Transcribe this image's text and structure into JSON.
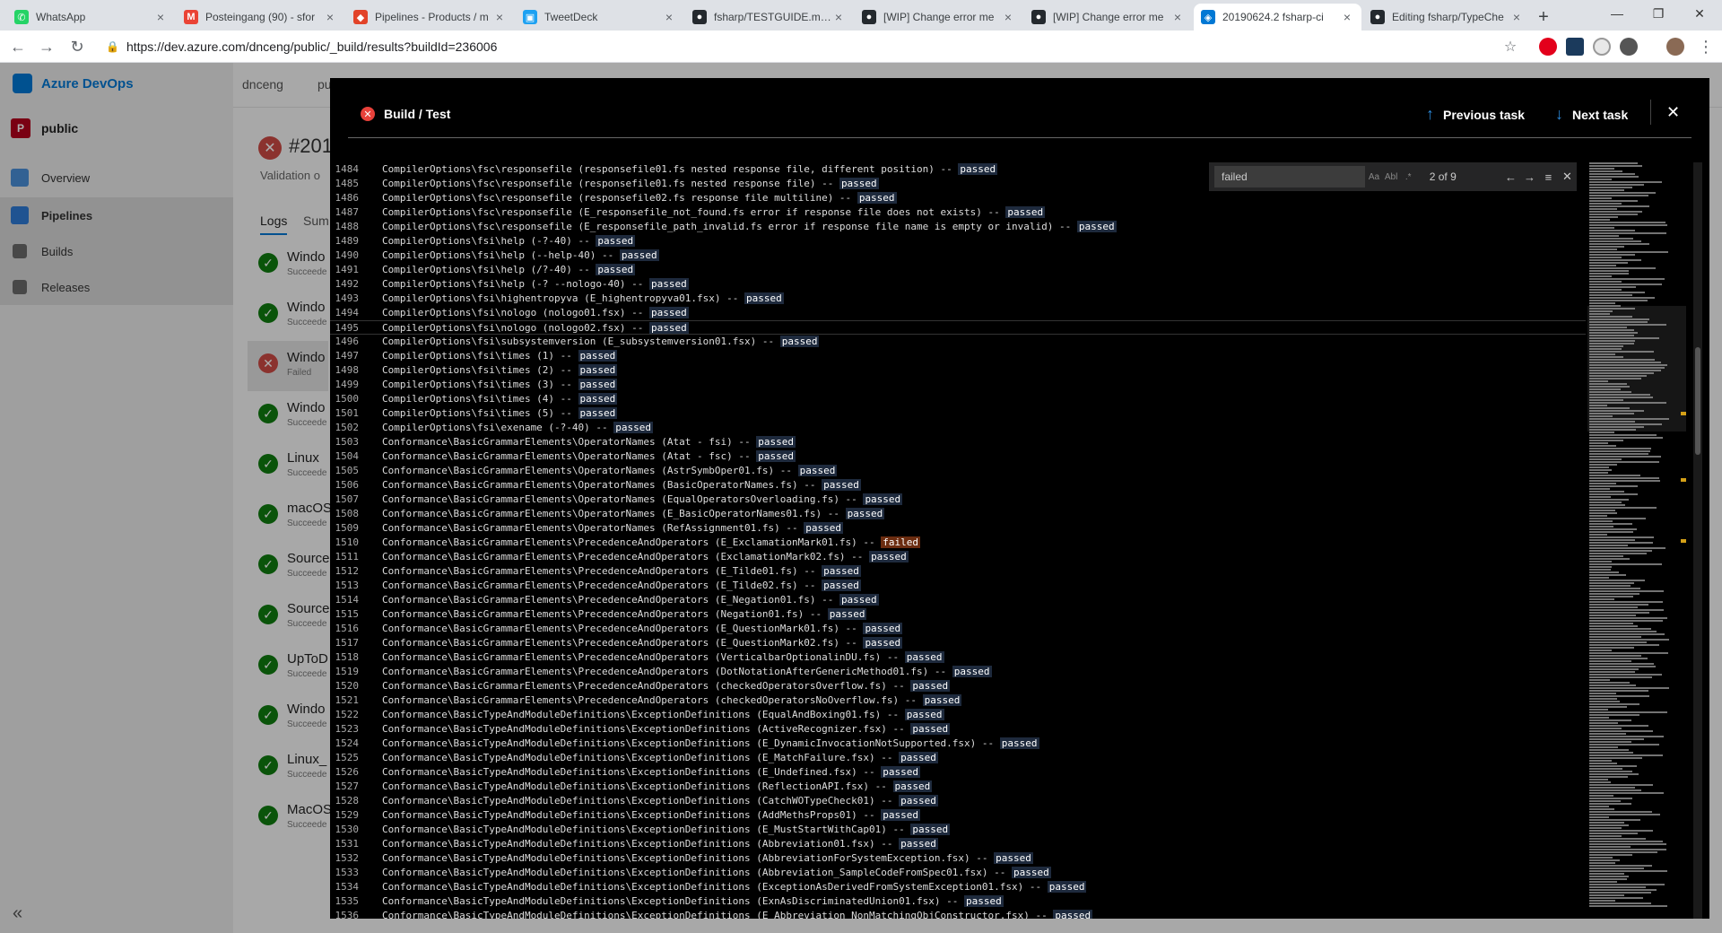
{
  "browser": {
    "tabs": [
      {
        "title": "WhatsApp",
        "icon": "whatsapp-icon",
        "color": "#25d366",
        "glyph": "✆"
      },
      {
        "title": "Posteingang (90) - sfor",
        "icon": "gmail-icon",
        "color": "#ea4335",
        "glyph": "M"
      },
      {
        "title": "Pipelines - Products / m",
        "icon": "gitlab-icon",
        "color": "#e24329",
        "glyph": "◆"
      },
      {
        "title": "TweetDeck",
        "icon": "tweetdeck-icon",
        "color": "#1da1f2",
        "glyph": "▣"
      },
      {
        "title": "fsharp/TESTGUIDE.md a",
        "icon": "github-icon",
        "color": "#24292e",
        "glyph": "●"
      },
      {
        "title": "[WIP] Change error me",
        "icon": "github-pr-icon",
        "color": "#24292e",
        "glyph": "●"
      },
      {
        "title": "[WIP] Change error me",
        "icon": "github-pr-icon",
        "color": "#24292e",
        "glyph": "●"
      },
      {
        "title": "20190624.2 fsharp-ci",
        "icon": "azure-devops-icon",
        "color": "#0078d4",
        "glyph": "◈",
        "active": true
      },
      {
        "title": "Editing fsharp/TypeChe",
        "icon": "github-icon",
        "color": "#24292e",
        "glyph": "●"
      }
    ],
    "url": "https://dev.azure.com/dnceng/public/_build/results?buildId=236006"
  },
  "ado": {
    "brand": "Azure DevOps",
    "org": "dnceng",
    "project_crumb": "pu",
    "project": "public",
    "project_initial": "P",
    "nav": {
      "overview": "Overview",
      "pipelines": "Pipelines",
      "builds": "Builds",
      "releases": "Releases"
    },
    "run_title": "#201",
    "run_sub": "Validation o",
    "tab_logs": "Logs",
    "tab_summary": "Sum",
    "jobs": [
      {
        "name": "Windo",
        "status": "Succeede",
        "ok": true
      },
      {
        "name": "Windo",
        "status": "Succeede",
        "ok": true
      },
      {
        "name": "Windo",
        "status": "Failed",
        "ok": false,
        "selected": true
      },
      {
        "name": "Windo",
        "status": "Succeede",
        "ok": true
      },
      {
        "name": "Linux",
        "status": "Succeede",
        "ok": true
      },
      {
        "name": "macOS",
        "status": "Succeede",
        "ok": true
      },
      {
        "name": "Source",
        "status": "Succeede",
        "ok": true
      },
      {
        "name": "Source",
        "status": "Succeede",
        "ok": true
      },
      {
        "name": "UpToD",
        "status": "Succeede",
        "ok": true
      },
      {
        "name": "Windo",
        "status": "Succeede",
        "ok": true
      },
      {
        "name": "Linux_",
        "status": "Succeede",
        "ok": true
      },
      {
        "name": "MacOS",
        "status": "Succeede",
        "ok": true
      }
    ]
  },
  "dialog": {
    "title": "Build / Test",
    "prev_task": "Previous task",
    "next_task": "Next task",
    "find": {
      "query": "failed",
      "count": "2 of 9",
      "opt_case": "Aa",
      "opt_word": "Abl",
      "opt_regex": ".*"
    },
    "current_line": 1495,
    "log_lines": [
      {
        "n": 1484,
        "text": "CompilerOptions\\fsc\\responsefile (responsefile01.fs nested response file, different position) -- ",
        "result": "passed"
      },
      {
        "n": 1485,
        "text": "CompilerOptions\\fsc\\responsefile (responsefile01.fs nested response file) -- ",
        "result": "passed"
      },
      {
        "n": 1486,
        "text": "CompilerOptions\\fsc\\responsefile (responsefile02.fs response file multiline) -- ",
        "result": "passed"
      },
      {
        "n": 1487,
        "text": "CompilerOptions\\fsc\\responsefile (E_responsefile_not_found.fs error if response file does not exists) -- ",
        "result": "passed"
      },
      {
        "n": 1488,
        "text": "CompilerOptions\\fsc\\responsefile (E_responsefile_path_invalid.fs error if response file name is empty or invalid) -- ",
        "result": "passed"
      },
      {
        "n": 1489,
        "text": "CompilerOptions\\fsi\\help (-?-40) -- ",
        "result": "passed"
      },
      {
        "n": 1490,
        "text": "CompilerOptions\\fsi\\help (--help-40) -- ",
        "result": "passed"
      },
      {
        "n": 1491,
        "text": "CompilerOptions\\fsi\\help (/?-40) -- ",
        "result": "passed"
      },
      {
        "n": 1492,
        "text": "CompilerOptions\\fsi\\help (-? --nologo-40) -- ",
        "result": "passed"
      },
      {
        "n": 1493,
        "text": "CompilerOptions\\fsi\\highentropyva (E_highentropyva01.fsx) -- ",
        "result": "passed"
      },
      {
        "n": 1494,
        "text": "CompilerOptions\\fsi\\nologo (nologo01.fsx) -- ",
        "result": "passed"
      },
      {
        "n": 1495,
        "text": "CompilerOptions\\fsi\\nologo (nologo02.fsx) -- ",
        "result": "passed"
      },
      {
        "n": 1496,
        "text": "CompilerOptions\\fsi\\subsystemversion (E_subsystemversion01.fsx) -- ",
        "result": "passed"
      },
      {
        "n": 1497,
        "text": "CompilerOptions\\fsi\\times (1) -- ",
        "result": "passed"
      },
      {
        "n": 1498,
        "text": "CompilerOptions\\fsi\\times (2) -- ",
        "result": "passed"
      },
      {
        "n": 1499,
        "text": "CompilerOptions\\fsi\\times (3) -- ",
        "result": "passed"
      },
      {
        "n": 1500,
        "text": "CompilerOptions\\fsi\\times (4) -- ",
        "result": "passed"
      },
      {
        "n": 1501,
        "text": "CompilerOptions\\fsi\\times (5) -- ",
        "result": "passed"
      },
      {
        "n": 1502,
        "text": "CompilerOptions\\fsi\\exename (-?-40) -- ",
        "result": "passed"
      },
      {
        "n": 1503,
        "text": "Conformance\\BasicGrammarElements\\OperatorNames (Atat - fsi) -- ",
        "result": "passed"
      },
      {
        "n": 1504,
        "text": "Conformance\\BasicGrammarElements\\OperatorNames (Atat - fsc) -- ",
        "result": "passed"
      },
      {
        "n": 1505,
        "text": "Conformance\\BasicGrammarElements\\OperatorNames (AstrSymbOper01.fs) -- ",
        "result": "passed"
      },
      {
        "n": 1506,
        "text": "Conformance\\BasicGrammarElements\\OperatorNames (BasicOperatorNames.fs) -- ",
        "result": "passed"
      },
      {
        "n": 1507,
        "text": "Conformance\\BasicGrammarElements\\OperatorNames (EqualOperatorsOverloading.fs) -- ",
        "result": "passed"
      },
      {
        "n": 1508,
        "text": "Conformance\\BasicGrammarElements\\OperatorNames (E_BasicOperatorNames01.fs) -- ",
        "result": "passed"
      },
      {
        "n": 1509,
        "text": "Conformance\\BasicGrammarElements\\OperatorNames (RefAssignment01.fs) -- ",
        "result": "passed"
      },
      {
        "n": 1510,
        "text": "Conformance\\BasicGrammarElements\\PrecedenceAndOperators (E_ExclamationMark01.fs) -- ",
        "result": "failed"
      },
      {
        "n": 1511,
        "text": "Conformance\\BasicGrammarElements\\PrecedenceAndOperators (ExclamationMark02.fs) -- ",
        "result": "passed"
      },
      {
        "n": 1512,
        "text": "Conformance\\BasicGrammarElements\\PrecedenceAndOperators (E_Tilde01.fs) -- ",
        "result": "passed"
      },
      {
        "n": 1513,
        "text": "Conformance\\BasicGrammarElements\\PrecedenceAndOperators (E_Tilde02.fs) -- ",
        "result": "passed"
      },
      {
        "n": 1514,
        "text": "Conformance\\BasicGrammarElements\\PrecedenceAndOperators (E_Negation01.fs) -- ",
        "result": "passed"
      },
      {
        "n": 1515,
        "text": "Conformance\\BasicGrammarElements\\PrecedenceAndOperators (Negation01.fs) -- ",
        "result": "passed"
      },
      {
        "n": 1516,
        "text": "Conformance\\BasicGrammarElements\\PrecedenceAndOperators (E_QuestionMark01.fs) -- ",
        "result": "passed"
      },
      {
        "n": 1517,
        "text": "Conformance\\BasicGrammarElements\\PrecedenceAndOperators (E_QuestionMark02.fs) -- ",
        "result": "passed"
      },
      {
        "n": 1518,
        "text": "Conformance\\BasicGrammarElements\\PrecedenceAndOperators (VerticalbarOptionalinDU.fs) -- ",
        "result": "passed"
      },
      {
        "n": 1519,
        "text": "Conformance\\BasicGrammarElements\\PrecedenceAndOperators (DotNotationAfterGenericMethod01.fs) -- ",
        "result": "passed"
      },
      {
        "n": 1520,
        "text": "Conformance\\BasicGrammarElements\\PrecedenceAndOperators (checkedOperatorsOverflow.fs) -- ",
        "result": "passed"
      },
      {
        "n": 1521,
        "text": "Conformance\\BasicGrammarElements\\PrecedenceAndOperators (checkedOperatorsNoOverflow.fs) -- ",
        "result": "passed"
      },
      {
        "n": 1522,
        "text": "Conformance\\BasicTypeAndModuleDefinitions\\ExceptionDefinitions (EqualAndBoxing01.fs) -- ",
        "result": "passed"
      },
      {
        "n": 1523,
        "text": "Conformance\\BasicTypeAndModuleDefinitions\\ExceptionDefinitions (ActiveRecognizer.fsx) -- ",
        "result": "passed"
      },
      {
        "n": 1524,
        "text": "Conformance\\BasicTypeAndModuleDefinitions\\ExceptionDefinitions (E_DynamicInvocationNotSupported.fsx) -- ",
        "result": "passed"
      },
      {
        "n": 1525,
        "text": "Conformance\\BasicTypeAndModuleDefinitions\\ExceptionDefinitions (E_MatchFailure.fsx) -- ",
        "result": "passed"
      },
      {
        "n": 1526,
        "text": "Conformance\\BasicTypeAndModuleDefinitions\\ExceptionDefinitions (E_Undefined.fsx) -- ",
        "result": "passed"
      },
      {
        "n": 1527,
        "text": "Conformance\\BasicTypeAndModuleDefinitions\\ExceptionDefinitions (ReflectionAPI.fsx) -- ",
        "result": "passed"
      },
      {
        "n": 1528,
        "text": "Conformance\\BasicTypeAndModuleDefinitions\\ExceptionDefinitions (CatchWOTypeCheck01) -- ",
        "result": "passed"
      },
      {
        "n": 1529,
        "text": "Conformance\\BasicTypeAndModuleDefinitions\\ExceptionDefinitions (AddMethsProps01) -- ",
        "result": "passed"
      },
      {
        "n": 1530,
        "text": "Conformance\\BasicTypeAndModuleDefinitions\\ExceptionDefinitions (E_MustStartWithCap01) -- ",
        "result": "passed"
      },
      {
        "n": 1531,
        "text": "Conformance\\BasicTypeAndModuleDefinitions\\ExceptionDefinitions (Abbreviation01.fsx) -- ",
        "result": "passed"
      },
      {
        "n": 1532,
        "text": "Conformance\\BasicTypeAndModuleDefinitions\\ExceptionDefinitions (AbbreviationForSystemException.fsx) -- ",
        "result": "passed"
      },
      {
        "n": 1533,
        "text": "Conformance\\BasicTypeAndModuleDefinitions\\ExceptionDefinitions (Abbreviation_SampleCodeFromSpec01.fsx) -- ",
        "result": "passed"
      },
      {
        "n": 1534,
        "text": "Conformance\\BasicTypeAndModuleDefinitions\\ExceptionDefinitions (ExceptionAsDerivedFromSystemException01.fsx) -- ",
        "result": "passed"
      },
      {
        "n": 1535,
        "text": "Conformance\\BasicTypeAndModuleDefinitions\\ExceptionDefinitions (ExnAsDiscriminatedUnion01.fsx) -- ",
        "result": "passed"
      },
      {
        "n": 1536,
        "text": "Conformance\\BasicTypeAndModuleDefinitions\\ExceptionDefinitions (E_Abbreviation_NonMatchingObjConstructor.fsx) -- ",
        "result": "passed"
      }
    ]
  }
}
